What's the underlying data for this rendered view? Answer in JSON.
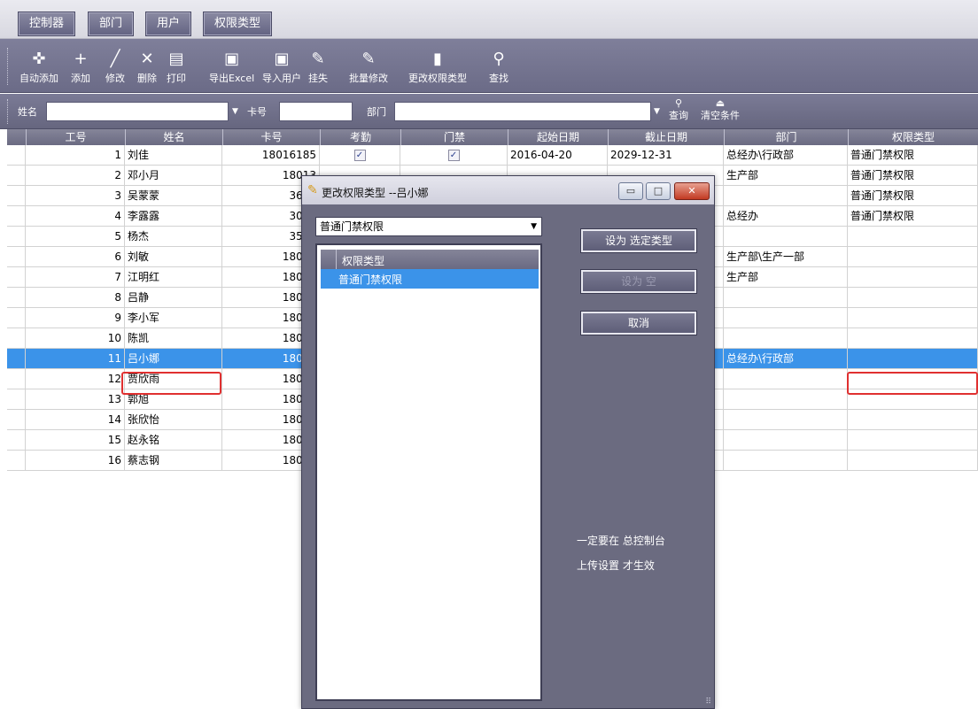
{
  "tabs": [
    "控制器",
    "部门",
    "用户",
    "权限类型"
  ],
  "toolbar": [
    {
      "icon": "add-auto-icon",
      "glyph": "✜",
      "label": "自动添加"
    },
    {
      "icon": "plus-icon",
      "glyph": "+",
      "label": "添加"
    },
    {
      "icon": "pencil-icon",
      "glyph": "╱",
      "label": "修改"
    },
    {
      "icon": "delete-x-icon",
      "glyph": "✕",
      "label": "删除"
    },
    {
      "icon": "printer-icon",
      "glyph": "▤",
      "label": "打印"
    },
    {
      "icon": "export-excel-icon",
      "glyph": "▣",
      "label": "导出Excel"
    },
    {
      "icon": "import-users-icon",
      "glyph": "▣",
      "label": "导入用户"
    },
    {
      "icon": "report-loss-icon",
      "glyph": "✎",
      "label": "挂失"
    },
    {
      "icon": "batch-edit-icon",
      "glyph": "✎",
      "label": "批量修改"
    },
    {
      "icon": "change-permission-icon",
      "glyph": "▮",
      "label": "更改权限类型"
    },
    {
      "icon": "search-icon",
      "glyph": "⚲",
      "label": "查找"
    }
  ],
  "filter": {
    "name_label": "姓名",
    "name_value": "",
    "card_label": "卡号",
    "card_value": "",
    "dept_label": "部门",
    "dept_value": "",
    "query_label": "查询",
    "clear_label": "清空条件"
  },
  "grid": {
    "headers": [
      "工号",
      "姓名",
      "卡号",
      "考勤",
      "门禁",
      "起始日期",
      "截止日期",
      "部门",
      "权限类型"
    ],
    "rows": [
      {
        "id": "1",
        "name": "刘佳",
        "card": "18016185",
        "att": true,
        "door": true,
        "start": "2016-04-20",
        "end": "2029-12-31",
        "dept": "总经办\\行政部",
        "perm": "普通门禁权限"
      },
      {
        "id": "2",
        "name": "邓小月",
        "card": "18013",
        "att": false,
        "door": false,
        "start": "",
        "end": "",
        "dept": "生产部",
        "perm": "普通门禁权限"
      },
      {
        "id": "3",
        "name": "吴蒙蒙",
        "card": "3652",
        "att": false,
        "door": false,
        "start": "",
        "end": "",
        "dept": "",
        "perm": "普通门禁权限"
      },
      {
        "id": "4",
        "name": "李露露",
        "card": "3000",
        "att": false,
        "door": false,
        "start": "",
        "end": "",
        "dept": "总经办",
        "perm": "普通门禁权限"
      },
      {
        "id": "5",
        "name": "杨杰",
        "card": "3544",
        "att": false,
        "door": false,
        "start": "",
        "end": "",
        "dept": "",
        "perm": ""
      },
      {
        "id": "6",
        "name": "刘敏",
        "card": "18013",
        "att": false,
        "door": false,
        "start": "",
        "end": "",
        "dept": "生产部\\生产一部",
        "perm": ""
      },
      {
        "id": "7",
        "name": "江明红",
        "card": "18013",
        "att": false,
        "door": false,
        "start": "",
        "end": "",
        "dept": "生产部",
        "perm": ""
      },
      {
        "id": "8",
        "name": "吕静",
        "card": "18013",
        "att": false,
        "door": false,
        "start": "",
        "end": "",
        "dept": "",
        "perm": ""
      },
      {
        "id": "9",
        "name": "李小军",
        "card": "18013",
        "att": false,
        "door": false,
        "start": "",
        "end": "",
        "dept": "",
        "perm": ""
      },
      {
        "id": "10",
        "name": "陈凯",
        "card": "18013",
        "att": false,
        "door": false,
        "start": "",
        "end": "",
        "dept": "",
        "perm": ""
      },
      {
        "id": "11",
        "name": "吕小娜",
        "card": "18013",
        "att": false,
        "door": false,
        "start": "",
        "end": "",
        "dept": "总经办\\行政部",
        "perm": "",
        "selected": true
      },
      {
        "id": "12",
        "name": "贾欣雨",
        "card": "18013",
        "att": false,
        "door": false,
        "start": "",
        "end": "",
        "dept": "",
        "perm": ""
      },
      {
        "id": "13",
        "name": "郭旭",
        "card": "18013",
        "att": false,
        "door": false,
        "start": "",
        "end": "",
        "dept": "",
        "perm": ""
      },
      {
        "id": "14",
        "name": "张欣怡",
        "card": "18013",
        "att": false,
        "door": false,
        "start": "",
        "end": "",
        "dept": "",
        "perm": ""
      },
      {
        "id": "15",
        "name": "赵永铭",
        "card": "18013",
        "att": false,
        "door": false,
        "start": "",
        "end": "",
        "dept": "",
        "perm": ""
      },
      {
        "id": "16",
        "name": "蔡志钢",
        "card": "18013",
        "att": false,
        "door": false,
        "start": "",
        "end": "",
        "dept": "",
        "perm": ""
      }
    ]
  },
  "dialog": {
    "title": "更改权限类型 --吕小娜",
    "combo_value": "普通门禁权限",
    "list_header": "权限类型",
    "list_items": [
      "普通门禁权限"
    ],
    "btn_set_selected": "设为 选定类型",
    "btn_set_empty": "设为 空",
    "btn_cancel": "取消",
    "note_line1": "一定要在 总控制台",
    "note_line2": "上传设置 才生效",
    "win_min": "▭",
    "win_max": "□",
    "win_close": "✕"
  },
  "colors": {
    "selection": "#3b93e9",
    "header": "#6a6a82",
    "highlight_border": "#e03030"
  }
}
